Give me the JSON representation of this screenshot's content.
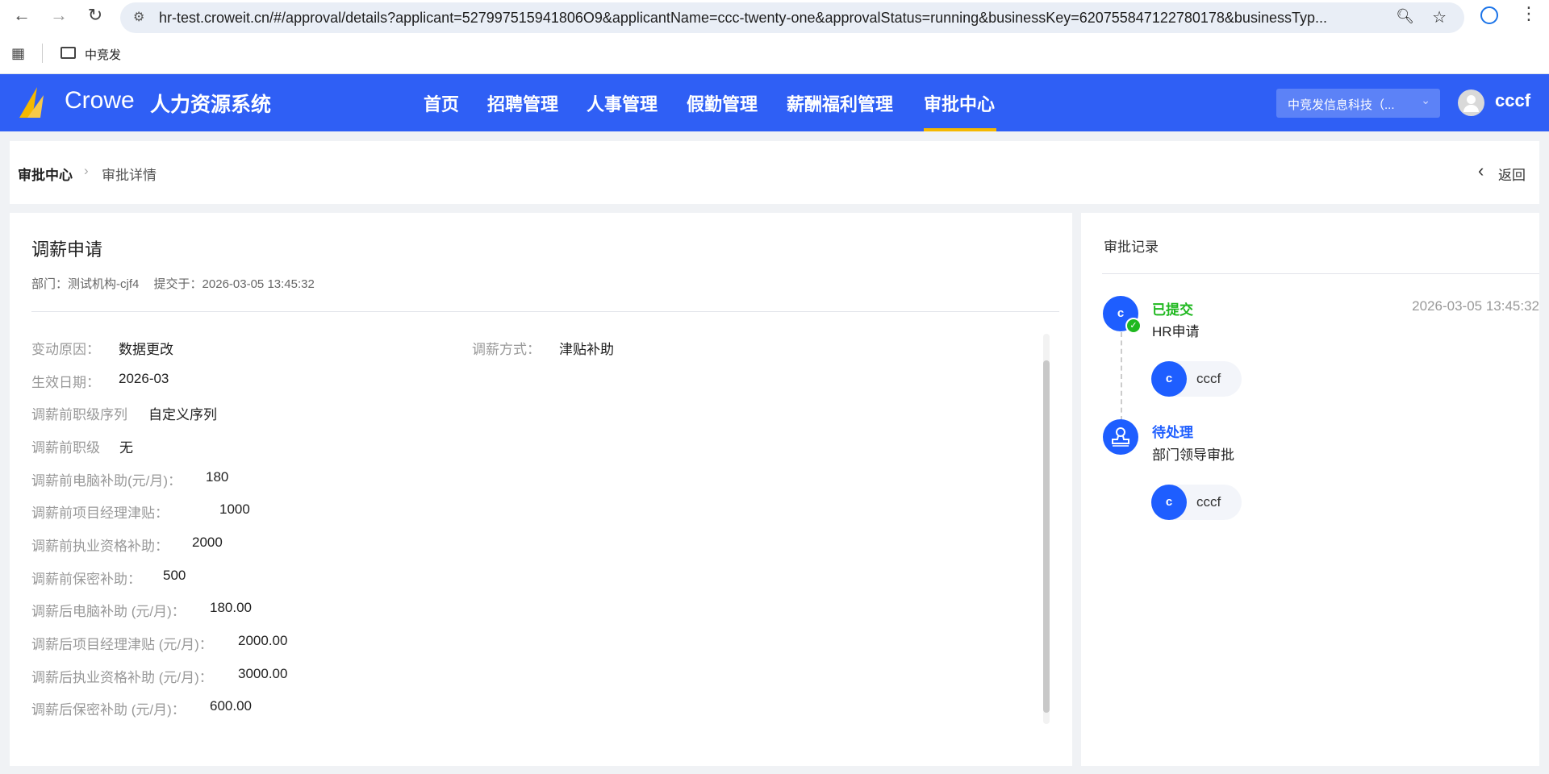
{
  "browser": {
    "url": "hr-test.croweit.cn/#/approval/details?applicant=527997515941806O9&applicantName=ccc-twenty-one&approvalStatus=running&businessKey=620755847122780178&businessTyp...",
    "bookmark": "中竞发"
  },
  "header": {
    "brand": "Crowe",
    "system": "人力资源系统",
    "nav": [
      "首页",
      "招聘管理",
      "人事管理",
      "假勤管理",
      "薪酬福利管理",
      "审批中心"
    ],
    "company": "中竞发信息科技（...",
    "user": "cccf",
    "accent": "#f5b800"
  },
  "breadcrumb": {
    "root": "审批中心",
    "current": "审批详情",
    "back": "返回"
  },
  "detail": {
    "title": "调薪申请",
    "dept_label": "部门：",
    "dept": "测试机构-cjf4",
    "submit_label": "提交于：",
    "submit_time": "2026-03-05 13:45:32",
    "rows": [
      {
        "label": "变动原因：",
        "value": "数据更改"
      },
      {
        "label": "调薪方式：",
        "value": "津贴补助"
      },
      {
        "label": "生效日期：",
        "value": "2026-03"
      },
      {
        "label": "调薪前职级序列",
        "value": "自定义序列"
      },
      {
        "label": "调薪前职级",
        "value": "无"
      },
      {
        "label": "调薪前电脑补助(元/月)：",
        "value": "180"
      },
      {
        "label": "调薪前项目经理津贴：",
        "value": "1000"
      },
      {
        "label": "调薪前执业资格补助：",
        "value": "2000"
      },
      {
        "label": "调薪前保密补助：",
        "value": "500"
      },
      {
        "label": "调薪后电脑补助 (元/月)：",
        "value": "180.00"
      },
      {
        "label": "调薪后项目经理津贴 (元/月)：",
        "value": "2000.00"
      },
      {
        "label": "调薪后执业资格补助 (元/月)：",
        "value": "3000.00"
      },
      {
        "label": "调薪后保密补助 (元/月)：",
        "value": "600.00"
      }
    ]
  },
  "record": {
    "title": "审批记录",
    "steps": [
      {
        "avatar": "c",
        "status": "已提交",
        "status_color": "#1fb81f",
        "name": "HR申请",
        "time": "2026-03-05 13:45:32",
        "approver_avatar": "c",
        "approver": "cccf"
      },
      {
        "status": "待处理",
        "status_color": "#1e5eff",
        "name": "部门领导审批",
        "approver_avatar": "c",
        "approver": "cccf"
      }
    ]
  }
}
